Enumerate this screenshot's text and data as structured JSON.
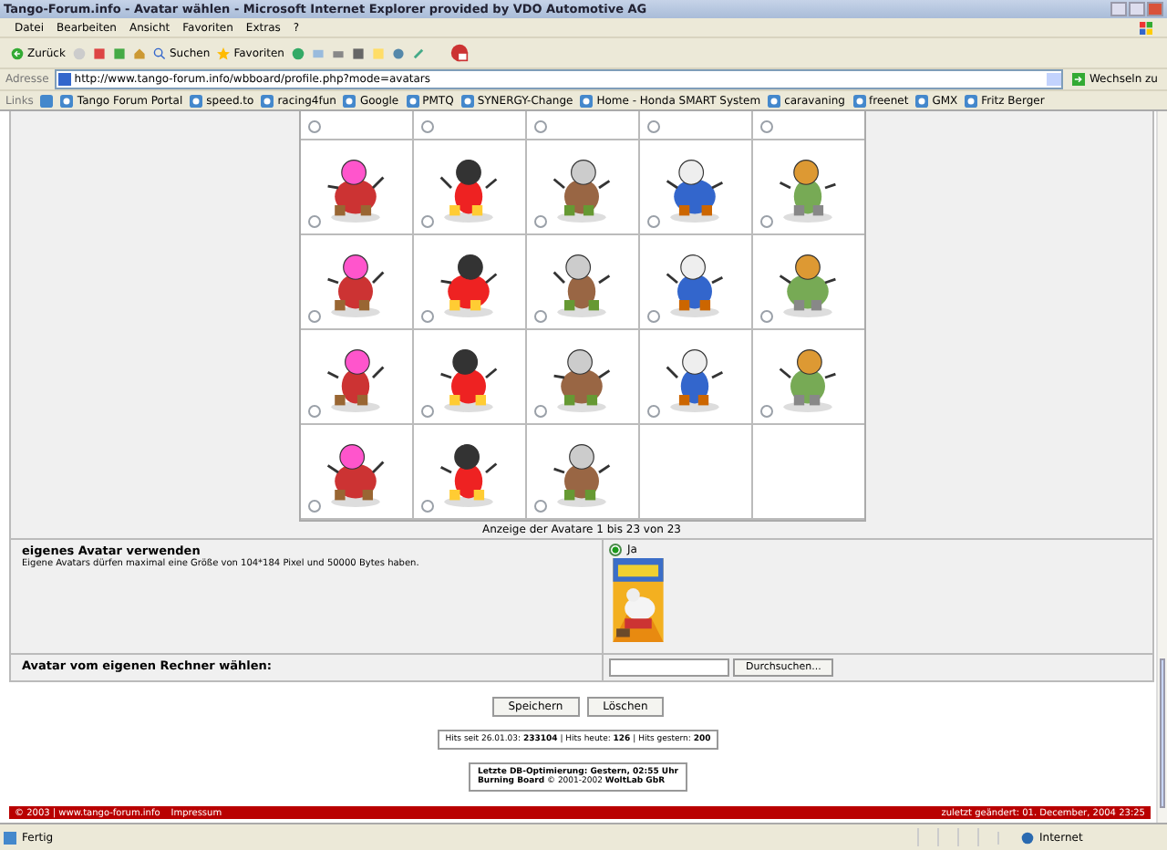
{
  "window": {
    "title": "Tango-Forum.info - Avatar wählen - Microsoft Internet Explorer provided by VDO Automotive AG"
  },
  "menu": [
    "Datei",
    "Bearbeiten",
    "Ansicht",
    "Favoriten",
    "Extras",
    "?"
  ],
  "toolbar": {
    "back": "Zurück",
    "search": "Suchen",
    "favorites": "Favoriten"
  },
  "address": {
    "label": "Adresse",
    "value": "http://www.tango-forum.info/wbboard/profile.php?mode=avatars",
    "go": "Wechseln zu"
  },
  "links": {
    "label": "Links",
    "items": [
      "Tango Forum Portal",
      "speed.to",
      "racing4fun",
      "Google",
      "PMTQ",
      "SYNERGY-Change",
      "Home - Honda SMART System",
      "caravaning",
      "freenet",
      "GMX",
      "Fritz Berger"
    ]
  },
  "avatars": [
    {
      "selected": false
    },
    {
      "selected": false
    },
    {
      "selected": false
    },
    {
      "selected": false
    },
    {
      "selected": false
    },
    {
      "selected": false
    },
    {
      "selected": false
    },
    {
      "selected": false
    },
    {
      "selected": false
    },
    {
      "selected": false
    },
    {
      "selected": false
    },
    {
      "selected": false
    },
    {
      "selected": false
    },
    {
      "selected": false
    },
    {
      "selected": false
    },
    {
      "selected": false
    },
    {
      "selected": false
    },
    {
      "selected": false
    },
    {
      "selected": false
    },
    {
      "selected": false
    },
    {
      "selected": false
    },
    {
      "selected": false
    },
    {
      "selected": false
    }
  ],
  "avatar_count": "Anzeige der Avatare 1 bis 23 von 23",
  "own_avatar": {
    "heading": "eigenes Avatar verwenden",
    "note": "Eigene Avatars dürfen maximal eine Größe von 104*184 Pixel und 50000 Bytes haben.",
    "option": "Ja",
    "selected": true
  },
  "upload": {
    "label": "Avatar vom eigenen Rechner wählen:",
    "browse": "Durchsuchen..."
  },
  "buttons": [
    "Speichern",
    "Löschen"
  ],
  "hits": "Hits seit 26.01.03: **233104** | Hits heute: **126** | Hits gestern: **200**",
  "info": [
    "Letzte DB-Optimierung: Gestern, 02:55 Uhr",
    "**Burning Board** © 2001-2002 **WoltLab GbR**"
  ],
  "footer": {
    "left": "© 2003 | www.tango-forum.info",
    "link": "Impressum",
    "right": "zuletzt geändert: 01. December, 2004 23:25"
  },
  "status": {
    "text": "Fertig",
    "zone": "Internet"
  }
}
